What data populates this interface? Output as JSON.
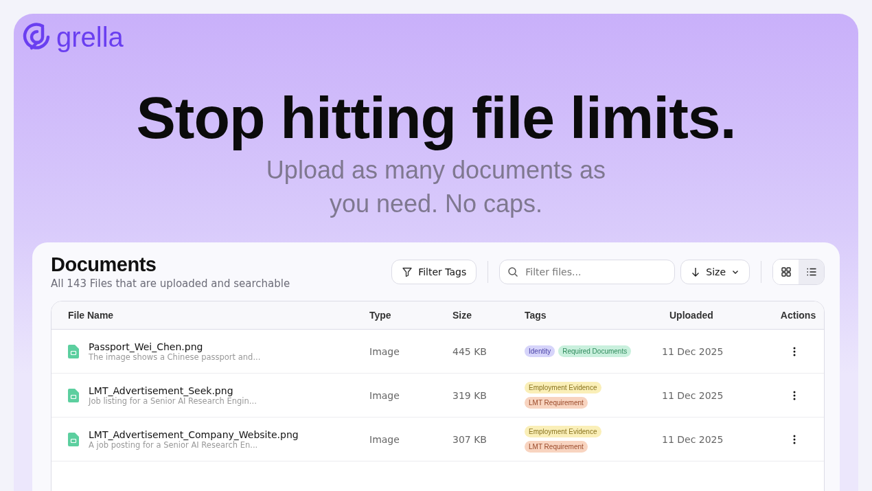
{
  "brand": {
    "name": "grella"
  },
  "hero": {
    "title": "Stop hitting file limits.",
    "subtitle": "Upload as many documents as you need. No caps."
  },
  "documents": {
    "title": "Documents",
    "subtitle": "All 143 Files that are uploaded and searchable",
    "filter_button": "Filter Tags",
    "search": {
      "placeholder": "Filter files..."
    },
    "sort": {
      "label": "Size"
    },
    "views": [
      {
        "kind": "grid",
        "selected": false
      },
      {
        "kind": "list",
        "selected": true
      }
    ],
    "table": {
      "columns": [
        "File Name",
        "Type",
        "Size",
        "Tags",
        "Uploaded",
        "Actions"
      ],
      "rows": [
        {
          "name": "Passport_Wei_Chen.png",
          "description": "The image shows a Chinese passport and...",
          "type": "Image",
          "size": "445 KB",
          "tags": [
            {
              "label": "Identity",
              "color": "#d6d4fa"
            },
            {
              "label": "Required Documents",
              "color": "#c9f0dd"
            }
          ],
          "uploaded": "11 Dec 2025"
        },
        {
          "name": "LMT_Advertisement_Seek.png",
          "description": "Job listing for a Senior AI Research Engin...",
          "type": "Image",
          "size": "319 KB",
          "tags": [
            {
              "label": "Employment Evidence",
              "color": "#faefb8"
            },
            {
              "label": "LMT Requirement",
              "color": "#f8d4c0"
            }
          ],
          "uploaded": "11 Dec 2025"
        },
        {
          "name": "LMT_Advertisement_Company_Website.png",
          "description": "A job posting for a Senior AI Research En...",
          "type": "Image",
          "size": "307 KB",
          "tags": [
            {
              "label": "Employment Evidence",
              "color": "#faefb8"
            },
            {
              "label": "LMT Requirement",
              "color": "#f8d4c0"
            }
          ],
          "uploaded": "11 Dec 2025"
        }
      ]
    }
  }
}
